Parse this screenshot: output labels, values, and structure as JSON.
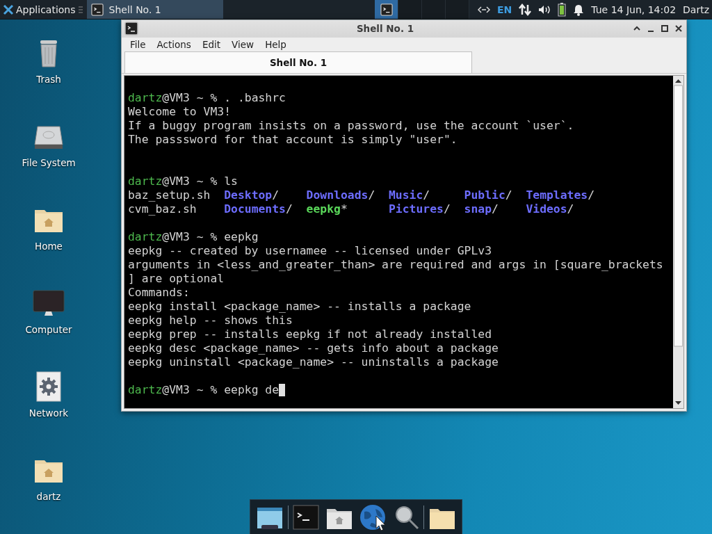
{
  "top_panel": {
    "menu_label": "Applications",
    "tasks": [
      {
        "title": "Shell No. 1",
        "selected": true
      }
    ],
    "workspaces": [
      {
        "selected": true
      },
      {
        "selected": false
      },
      {
        "selected": false
      },
      {
        "selected": false
      }
    ],
    "keyboard_layout": "EN",
    "clock": "Tue 14 Jun, 14:02",
    "user": "Dartz"
  },
  "desktop_icons": [
    {
      "label": "Trash",
      "kind": "trash"
    },
    {
      "label": "File System",
      "kind": "drive"
    },
    {
      "label": "Home",
      "kind": "home"
    },
    {
      "label": "Computer",
      "kind": "monitor"
    },
    {
      "label": "Network",
      "kind": "network"
    },
    {
      "label": "dartz",
      "kind": "home"
    }
  ],
  "window": {
    "title": "Shell No. 1",
    "menu": [
      "File",
      "Actions",
      "Edit",
      "View",
      "Help"
    ],
    "tabs": [
      {
        "label": "Shell No. 1",
        "selected": true
      }
    ],
    "terminal": {
      "lines": [
        {
          "kind": "output",
          "segments": [
            {
              "kind": "user",
              "text": "dartz"
            },
            {
              "kind": "text",
              "text": "@VM3 ~ % . .bashrc"
            }
          ]
        },
        {
          "kind": "output",
          "segments": [
            {
              "kind": "text",
              "text": "Welcome to VM3!"
            }
          ]
        },
        {
          "kind": "output",
          "segments": [
            {
              "kind": "text",
              "text": "If a buggy program insists on a password, use the account `user`."
            }
          ]
        },
        {
          "kind": "output",
          "segments": [
            {
              "kind": "text",
              "text": "The passsword for that account is simply \"user\"."
            }
          ]
        },
        {
          "kind": "blank"
        },
        {
          "kind": "blank"
        },
        {
          "kind": "output",
          "segments": [
            {
              "kind": "user",
              "text": "dartz"
            },
            {
              "kind": "text",
              "text": "@VM3 ~ % ls"
            }
          ]
        },
        {
          "kind": "output",
          "segments": [
            {
              "kind": "text",
              "text": "baz_setup.sh  "
            },
            {
              "kind": "dir",
              "text": "Desktop"
            },
            {
              "kind": "text",
              "text": "/    "
            },
            {
              "kind": "dir",
              "text": "Downloads"
            },
            {
              "kind": "text",
              "text": "/  "
            },
            {
              "kind": "dir",
              "text": "Music"
            },
            {
              "kind": "text",
              "text": "/     "
            },
            {
              "kind": "dir",
              "text": "Public"
            },
            {
              "kind": "text",
              "text": "/  "
            },
            {
              "kind": "dir",
              "text": "Templates"
            },
            {
              "kind": "text",
              "text": "/"
            }
          ]
        },
        {
          "kind": "output",
          "segments": [
            {
              "kind": "text",
              "text": "cvm_baz.sh    "
            },
            {
              "kind": "dir",
              "text": "Documents"
            },
            {
              "kind": "text",
              "text": "/  "
            },
            {
              "kind": "exec",
              "text": "eepkg"
            },
            {
              "kind": "text",
              "text": "*      "
            },
            {
              "kind": "dir",
              "text": "Pictures"
            },
            {
              "kind": "text",
              "text": "/  "
            },
            {
              "kind": "dir",
              "text": "snap"
            },
            {
              "kind": "text",
              "text": "/    "
            },
            {
              "kind": "dir",
              "text": "Videos"
            },
            {
              "kind": "text",
              "text": "/"
            }
          ]
        },
        {
          "kind": "blank"
        },
        {
          "kind": "output",
          "segments": [
            {
              "kind": "user",
              "text": "dartz"
            },
            {
              "kind": "text",
              "text": "@VM3 ~ % eepkg"
            }
          ]
        },
        {
          "kind": "output",
          "segments": [
            {
              "kind": "text",
              "text": "eepkg -- created by usernamee -- licensed under GPLv3"
            }
          ]
        },
        {
          "kind": "output",
          "segments": [
            {
              "kind": "text",
              "text": "arguments in <less_and_greater_than> are required and args in [square_brackets"
            }
          ]
        },
        {
          "kind": "output",
          "segments": [
            {
              "kind": "text",
              "text": "] are optional"
            }
          ]
        },
        {
          "kind": "output",
          "segments": [
            {
              "kind": "text",
              "text": "Commands:"
            }
          ]
        },
        {
          "kind": "output",
          "segments": [
            {
              "kind": "text",
              "text": "eepkg install <package_name> -- installs a package"
            }
          ]
        },
        {
          "kind": "output",
          "segments": [
            {
              "kind": "text",
              "text": "eepkg help -- shows this"
            }
          ]
        },
        {
          "kind": "output",
          "segments": [
            {
              "kind": "text",
              "text": "eepkg prep -- installs eepkg if not already installed"
            }
          ]
        },
        {
          "kind": "output",
          "segments": [
            {
              "kind": "text",
              "text": "eepkg desc <package_name> -- gets info about a package"
            }
          ]
        },
        {
          "kind": "output",
          "segments": [
            {
              "kind": "text",
              "text": "eepkg uninstall <package_name> -- uninstalls a package"
            }
          ]
        },
        {
          "kind": "blank"
        },
        {
          "kind": "output",
          "cursor": true,
          "segments": [
            {
              "kind": "user",
              "text": "dartz"
            },
            {
              "kind": "text",
              "text": "@VM3 ~ % eepkg de"
            }
          ]
        }
      ]
    }
  },
  "dock": {
    "items": [
      {
        "kind": "window"
      },
      {
        "kind": "separator"
      },
      {
        "kind": "terminal"
      },
      {
        "kind": "home"
      },
      {
        "kind": "globe"
      },
      {
        "kind": "search"
      },
      {
        "kind": "separator"
      },
      {
        "kind": "folder"
      }
    ]
  }
}
